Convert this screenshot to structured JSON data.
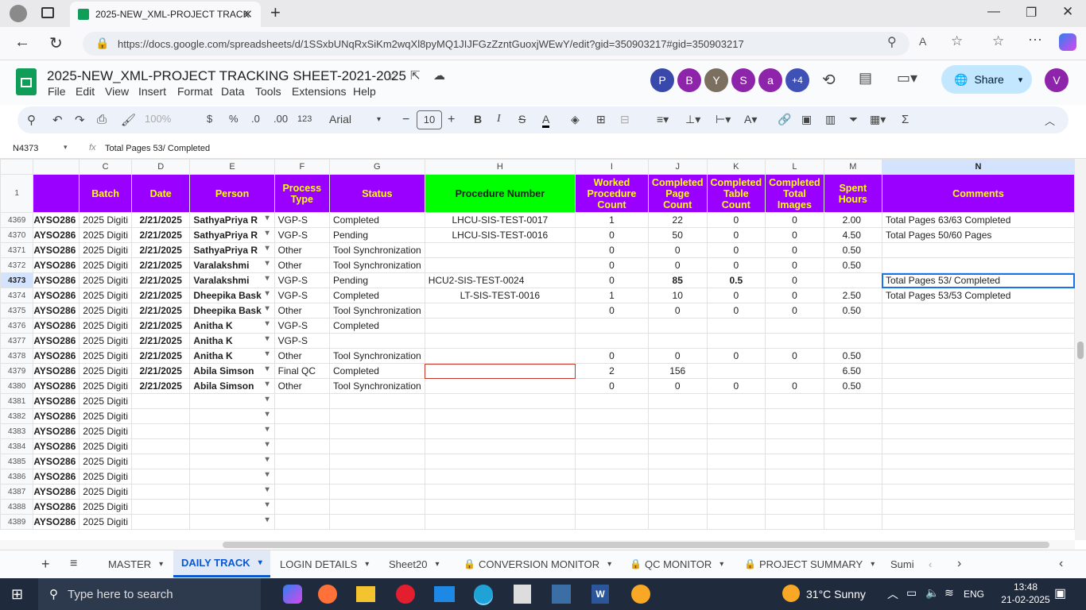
{
  "browser": {
    "tab_title": "2025-NEW_XML-PROJECT TRACK",
    "url": "https://docs.google.com/spreadsheets/d/1SSxbUNqRxSiKm2wqXl8pyMQ1JIJFGzZzntGuoxjWEwY/edit?gid=350903217#gid=350903217"
  },
  "doc": {
    "title": "2025-NEW_XML-PROJECT TRACKING SHEET-2021-2025",
    "menus": [
      "File",
      "Edit",
      "View",
      "Insert",
      "Format",
      "Data",
      "Tools",
      "Extensions",
      "Help"
    ],
    "avatars": [
      {
        "letter": "P",
        "color": "#3949ab"
      },
      {
        "letter": "B",
        "color": "#8e24aa"
      },
      {
        "letter": "Y",
        "color": "#7b6f5f"
      },
      {
        "letter": "S",
        "color": "#8e24aa"
      },
      {
        "letter": "a",
        "color": "#8e24aa"
      }
    ],
    "more_avatars": "+4",
    "share_label": "Share",
    "user_initial": "V"
  },
  "toolbar": {
    "zoom": "100%",
    "currency": "$",
    "percent": "%",
    "dec_dec": ".0",
    "dec_inc": ".00",
    "format_123": "123",
    "font": "Arial",
    "font_size": "10"
  },
  "formula_bar": {
    "cell_ref": "N4373",
    "fx": "fx",
    "content": "Total Pages 53/ Completed"
  },
  "columns": [
    "C",
    "D",
    "E",
    "F",
    "G",
    "H",
    "I",
    "J",
    "K",
    "L",
    "M",
    "N"
  ],
  "header_row": {
    "num": "1",
    "batch": "Batch",
    "date": "Date",
    "person": "Person",
    "process_type": "Process Type",
    "status": "Status",
    "procedure_number": "Procedure Number",
    "worked_count": "Worked Procedure Count",
    "completed_page": "Completed Page Count",
    "completed_table": "Completed Table Count",
    "completed_images": "Completed Total Images",
    "spent_hours": "Spent Hours",
    "comments": "Comments"
  },
  "rows": [
    {
      "n": "4369",
      "b": "AYSO286",
      "c": "2025 Digiti",
      "d": "2/21/2025",
      "e": "SathyaPriya R",
      "f": "VGP-S",
      "g": "Completed",
      "h": "LHCU-SIS-TEST-0017",
      "i": "1",
      "j": "22",
      "k": "0",
      "l": "0",
      "m": "2.00",
      "nn": "Total Pages 63/63 Completed"
    },
    {
      "n": "4370",
      "b": "AYSO286",
      "c": "2025 Digiti",
      "d": "2/21/2025",
      "e": "SathyaPriya R",
      "f": "VGP-S",
      "g": "Pending",
      "h": "LHCU-SIS-TEST-0016",
      "i": "0",
      "j": "50",
      "k": "0",
      "l": "0",
      "m": "4.50",
      "nn": "Total Pages 50/60 Pages"
    },
    {
      "n": "4371",
      "b": "AYSO286",
      "c": "2025 Digiti",
      "d": "2/21/2025",
      "e": "SathyaPriya R",
      "f": "Other",
      "g": "Tool Synchronization",
      "h": "",
      "i": "0",
      "j": "0",
      "k": "0",
      "l": "0",
      "m": "0.50",
      "nn": ""
    },
    {
      "n": "4372",
      "b": "AYSO286",
      "c": "2025 Digiti",
      "d": "2/21/2025",
      "e": "Varalakshmi",
      "f": "Other",
      "g": "Tool Synchronization",
      "h": "",
      "i": "0",
      "j": "0",
      "k": "0",
      "l": "0",
      "m": "0.50",
      "nn": ""
    },
    {
      "n": "4373",
      "b": "AYSO286",
      "c": "2025 Digiti",
      "d": "2/21/2025",
      "e": "Varalakshmi",
      "f": "VGP-S",
      "g": "Pending",
      "h": "HCU2-SIS-TEST-0024",
      "i": "0",
      "j": "85",
      "k": "0.5",
      "l": "0",
      "m": "",
      "nn": "Total Pages 53/ Completed"
    },
    {
      "n": "4374",
      "b": "AYSO286",
      "c": "2025 Digiti",
      "d": "2/21/2025",
      "e": "Dheepika Bask",
      "f": "VGP-S",
      "g": "Completed",
      "h": "LT-SIS-TEST-0016",
      "i": "1",
      "j": "10",
      "k": "0",
      "l": "0",
      "m": "2.50",
      "nn": "Total Pages 53/53 Completed"
    },
    {
      "n": "4375",
      "b": "AYSO286",
      "c": "2025 Digiti",
      "d": "2/21/2025",
      "e": "Dheepika Bask",
      "f": "Other",
      "g": "Tool Synchronization",
      "h": "",
      "i": "0",
      "j": "0",
      "k": "0",
      "l": "0",
      "m": "0.50",
      "nn": ""
    },
    {
      "n": "4376",
      "b": "AYSO286",
      "c": "2025 Digiti",
      "d": "2/21/2025",
      "e": "Anitha K",
      "f": "VGP-S",
      "g": "Completed",
      "h": "",
      "i": "",
      "j": "",
      "k": "",
      "l": "",
      "m": "",
      "nn": ""
    },
    {
      "n": "4377",
      "b": "AYSO286",
      "c": "2025 Digiti",
      "d": "2/21/2025",
      "e": "Anitha K",
      "f": "VGP-S",
      "g": "",
      "h": "",
      "i": "",
      "j": "",
      "k": "",
      "l": "",
      "m": "",
      "nn": ""
    },
    {
      "n": "4378",
      "b": "AYSO286",
      "c": "2025 Digiti",
      "d": "2/21/2025",
      "e": "Anitha K",
      "f": "Other",
      "g": "Tool Synchronization",
      "h": "",
      "i": "0",
      "j": "0",
      "k": "0",
      "l": "0",
      "m": "0.50",
      "nn": ""
    },
    {
      "n": "4379",
      "b": "AYSO286",
      "c": "2025 Digiti",
      "d": "2/21/2025",
      "e": "Abila Simson",
      "f": "Final QC",
      "g": "Completed",
      "h": "",
      "i": "2",
      "j": "156",
      "k": "",
      "l": "",
      "m": "6.50",
      "nn": ""
    },
    {
      "n": "4380",
      "b": "AYSO286",
      "c": "2025 Digiti",
      "d": "2/21/2025",
      "e": "Abila Simson",
      "f": "Other",
      "g": "Tool Synchronization",
      "h": "",
      "i": "0",
      "j": "0",
      "k": "0",
      "l": "0",
      "m": "0.50",
      "nn": ""
    },
    {
      "n": "4381",
      "b": "AYSO286",
      "c": "2025 Digiti",
      "d": "",
      "e": "",
      "f": "",
      "g": "",
      "h": "",
      "i": "",
      "j": "",
      "k": "",
      "l": "",
      "m": "",
      "nn": ""
    },
    {
      "n": "4382",
      "b": "AYSO286",
      "c": "2025 Digiti",
      "d": "",
      "e": "",
      "f": "",
      "g": "",
      "h": "",
      "i": "",
      "j": "",
      "k": "",
      "l": "",
      "m": "",
      "nn": ""
    },
    {
      "n": "4383",
      "b": "AYSO286",
      "c": "2025 Digiti",
      "d": "",
      "e": "",
      "f": "",
      "g": "",
      "h": "",
      "i": "",
      "j": "",
      "k": "",
      "l": "",
      "m": "",
      "nn": ""
    },
    {
      "n": "4384",
      "b": "AYSO286",
      "c": "2025 Digiti",
      "d": "",
      "e": "",
      "f": "",
      "g": "",
      "h": "",
      "i": "",
      "j": "",
      "k": "",
      "l": "",
      "m": "",
      "nn": ""
    },
    {
      "n": "4385",
      "b": "AYSO286",
      "c": "2025 Digiti",
      "d": "",
      "e": "",
      "f": "",
      "g": "",
      "h": "",
      "i": "",
      "j": "",
      "k": "",
      "l": "",
      "m": "",
      "nn": ""
    },
    {
      "n": "4386",
      "b": "AYSO286",
      "c": "2025 Digiti",
      "d": "",
      "e": "",
      "f": "",
      "g": "",
      "h": "",
      "i": "",
      "j": "",
      "k": "",
      "l": "",
      "m": "",
      "nn": ""
    },
    {
      "n": "4387",
      "b": "AYSO286",
      "c": "2025 Digiti",
      "d": "",
      "e": "",
      "f": "",
      "g": "",
      "h": "",
      "i": "",
      "j": "",
      "k": "",
      "l": "",
      "m": "",
      "nn": ""
    },
    {
      "n": "4388",
      "b": "AYSO286",
      "c": "2025 Digiti",
      "d": "",
      "e": "",
      "f": "",
      "g": "",
      "h": "",
      "i": "",
      "j": "",
      "k": "",
      "l": "",
      "m": "",
      "nn": ""
    },
    {
      "n": "4389",
      "b": "AYSO286",
      "c": "2025 Digiti",
      "d": "",
      "e": "",
      "f": "",
      "g": "",
      "h": "",
      "i": "",
      "j": "",
      "k": "",
      "l": "",
      "m": "",
      "nn": ""
    }
  ],
  "sheet_tabs": [
    "MASTER",
    "DAILY TRACK",
    "LOGIN DETAILS",
    "Sheet20",
    "CONVERSION MONITOR",
    "QC MONITOR",
    "PROJECT SUMMARY",
    "Sumi"
  ],
  "taskbar": {
    "search_placeholder": "Type here to search",
    "weather": "31°C  Sunny",
    "lang": "ENG",
    "time": "13:48",
    "date": "21-02-2025"
  }
}
